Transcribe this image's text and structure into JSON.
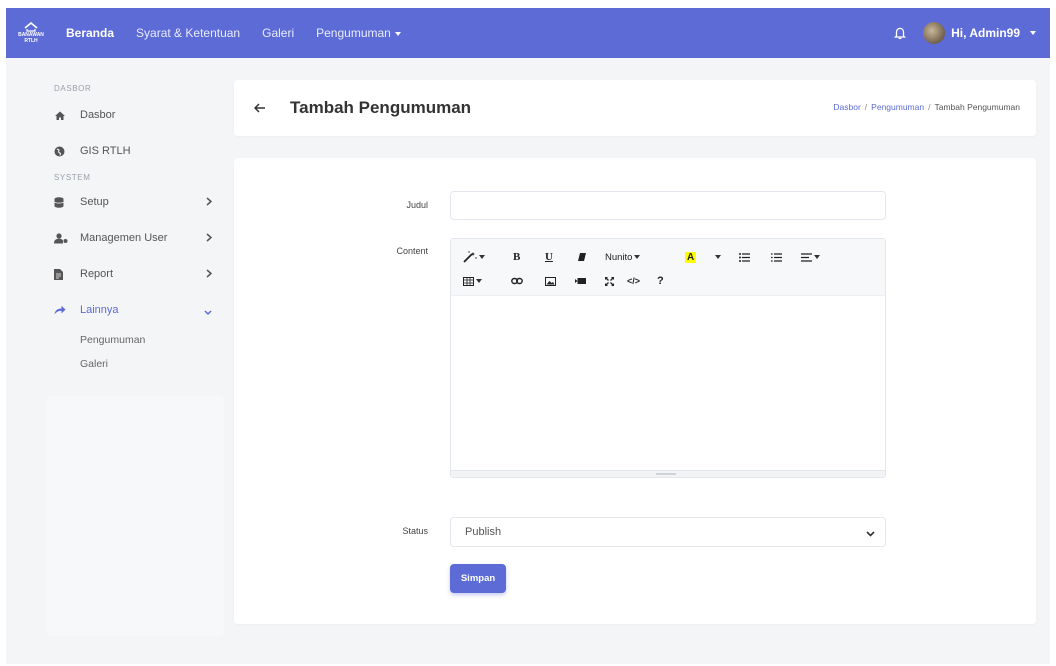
{
  "brand": {
    "logo_text": "BANAWAN\nRTLH",
    "logo_line1": "BANAWAN",
    "logo_line2": "RTLH"
  },
  "navbar": {
    "items": [
      {
        "label": "Beranda",
        "active": true
      },
      {
        "label": "Syarat & Ketentuan",
        "active": false
      },
      {
        "label": "Galeri",
        "active": false
      },
      {
        "label": "Pengumuman",
        "active": false,
        "dropdown": true
      }
    ],
    "user_label": "Hi, Admin99",
    "bell_icon": "bell-icon"
  },
  "sidebar": {
    "sections": [
      {
        "heading": "DASBOR",
        "items": [
          {
            "label": "Dasbor",
            "icon": "home-icon"
          },
          {
            "label": "GIS RTLH",
            "icon": "globe-icon"
          }
        ]
      },
      {
        "heading": "SYSTEM",
        "items": [
          {
            "label": "Setup",
            "icon": "database-icon",
            "chevron": "right"
          },
          {
            "label": "Managemen User",
            "icon": "user-cog-icon",
            "chevron": "right"
          },
          {
            "label": "Report",
            "icon": "file-icon",
            "chevron": "right"
          },
          {
            "label": "Lainnya",
            "icon": "share-icon",
            "chevron": "down",
            "active": true
          }
        ]
      }
    ],
    "sub_items": [
      "Pengumuman",
      "Galeri"
    ]
  },
  "header": {
    "title": "Tambah Pengumuman",
    "breadcrumb": [
      "Dasbor",
      "Pengumuman",
      "Tambah Pengumuman"
    ]
  },
  "form": {
    "title_label": "Judul",
    "title_value": "",
    "content_label": "Content",
    "editor_font": "Nunito",
    "editor_tools": [
      "magic-icon",
      "bold-icon",
      "underline-icon",
      "eraser-icon",
      "font-name",
      "text-color-icon",
      "bullet-list-icon",
      "ordered-list-icon",
      "align-icon",
      "table-icon",
      "link-icon",
      "image-icon",
      "video-icon",
      "fullscreen-icon",
      "code-view-icon",
      "help-icon"
    ],
    "status_label": "Status",
    "status_value": "Publish",
    "submit_label": "Simpan"
  },
  "colors": {
    "primary": "#5c6bd6",
    "background": "#f4f5f7",
    "highlight": "#ffff00"
  }
}
